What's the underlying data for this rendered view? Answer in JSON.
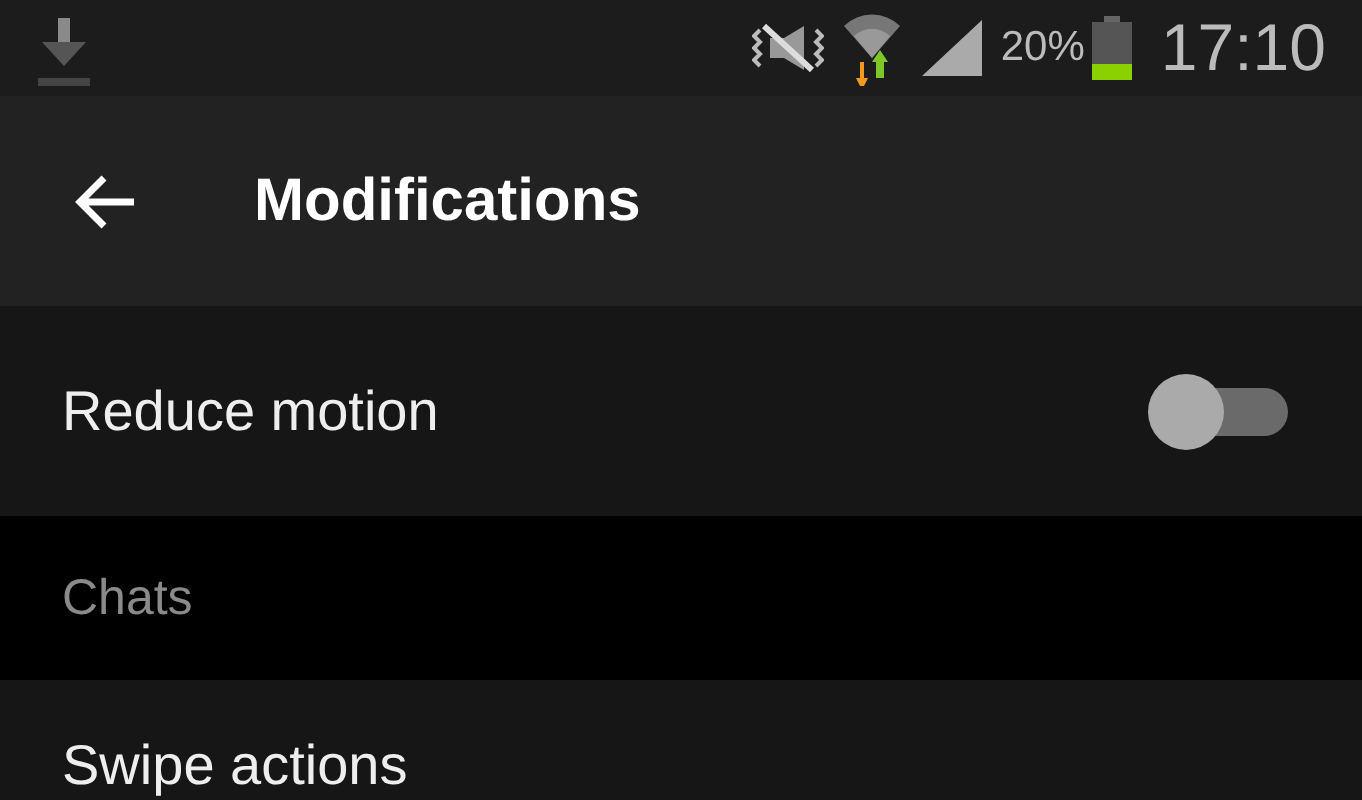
{
  "status_bar": {
    "battery_percent": "20%",
    "time": "17:10"
  },
  "app_bar": {
    "title": "Modifications"
  },
  "items": [
    {
      "kind": "toggle",
      "label": "Reduce motion",
      "on": false
    },
    {
      "kind": "header",
      "label": "Chats"
    },
    {
      "kind": "plain",
      "label": "Swipe actions"
    }
  ]
}
